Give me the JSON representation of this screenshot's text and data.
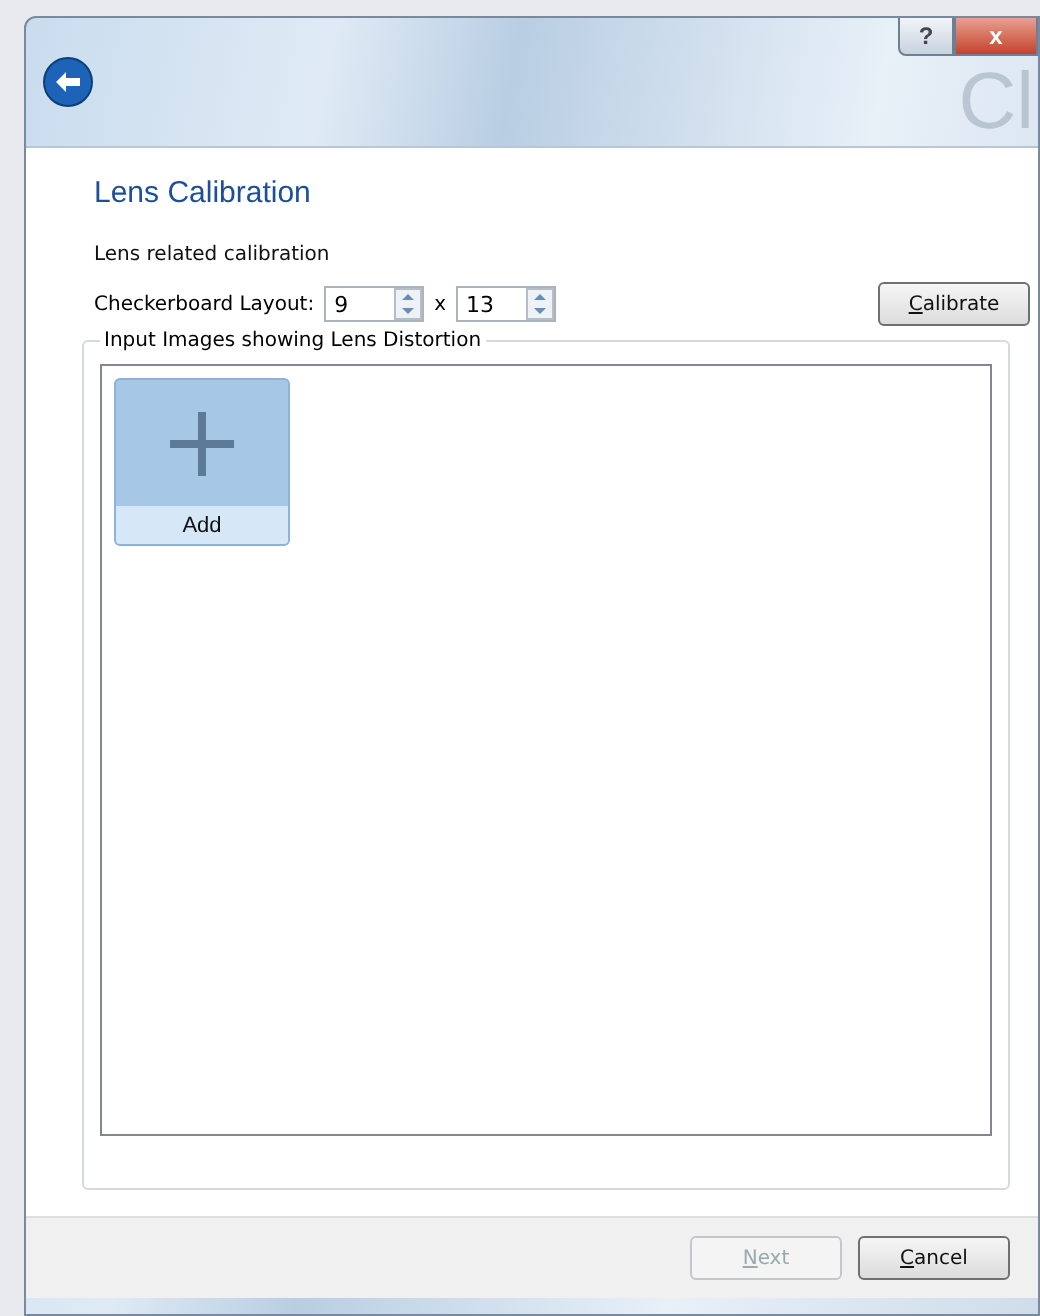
{
  "window": {
    "backdrop_text": "Cl",
    "buttons": [
      {
        "kind": "help",
        "label": "?"
      },
      {
        "kind": "close",
        "label": "x"
      }
    ]
  },
  "page": {
    "title": "Lens Calibration",
    "subtitle": "Lens related calibration"
  },
  "layout": {
    "label": "Checkerboard Layout:",
    "rows": "9",
    "separator": "x",
    "columns": "13"
  },
  "calibrate_button": {
    "label": "Calibrate",
    "disabled": false
  },
  "images_group": {
    "title": "Input Images showing Lens Distortion",
    "items": [
      {
        "kind": "add",
        "label": "Add",
        "selected": true
      }
    ]
  },
  "footer_buttons": [
    {
      "label": "Next",
      "disabled": true
    },
    {
      "label": "Cancel",
      "disabled": false
    }
  ]
}
